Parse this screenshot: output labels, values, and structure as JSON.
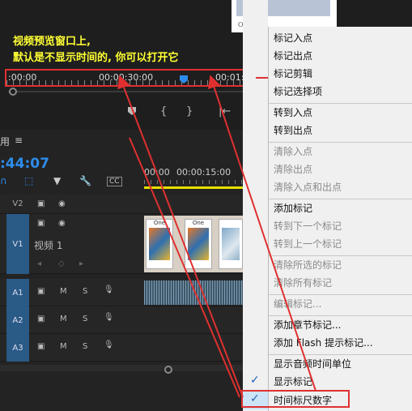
{
  "preview": {
    "thumb_caption": "One toy.",
    "annotation_line1": "视频预览窗口上,",
    "annotation_line2": "默认是不显示时间的, 你可以打开它",
    "time_labels": [
      ":00:00",
      "00:00:30:00",
      "00:01:"
    ]
  },
  "controls": {
    "in_icon": "{",
    "out_icon": "}",
    "goto_in_icon": "|←"
  },
  "timeline": {
    "tab_label": "用",
    "menu_icon": "≡",
    "timecode": ":44:07",
    "ruler_labels": [
      "00:00",
      "00:00:15:00"
    ],
    "cc_label": "CC",
    "tracks": {
      "v2": "V2",
      "v1": "V1",
      "v1_name": "视频 1",
      "a1": "A1",
      "a2": "A2",
      "a3": "A3",
      "mute": "M",
      "solo": "S"
    },
    "clip_frame_label": "One"
  },
  "menu": {
    "items": [
      {
        "label": "标记入点",
        "enabled": true
      },
      {
        "label": "标记出点",
        "enabled": true
      },
      {
        "label": "标记剪辑",
        "enabled": true
      },
      {
        "label": "标记选择项",
        "enabled": true
      },
      {
        "label": "转到入点",
        "enabled": true
      },
      {
        "label": "转到出点",
        "enabled": true
      },
      {
        "label": "清除入点",
        "enabled": false
      },
      {
        "label": "清除出点",
        "enabled": false
      },
      {
        "label": "清除入点和出点",
        "enabled": false
      },
      {
        "label": "添加标记",
        "enabled": true
      },
      {
        "label": "转到下一个标记",
        "enabled": false
      },
      {
        "label": "转到上一个标记",
        "enabled": false
      },
      {
        "label": "清除所选的标记",
        "enabled": false
      },
      {
        "label": "清除所有标记",
        "enabled": false
      },
      {
        "label": "编辑标记...",
        "enabled": false
      },
      {
        "label": "添加章节标记...",
        "enabled": true
      },
      {
        "label": "添加 Flash 提示标记...",
        "enabled": true
      },
      {
        "label": "显示音频时间单位",
        "enabled": true
      },
      {
        "label": "显示标记",
        "enabled": true,
        "checked": true
      },
      {
        "label": "时间标尺数字",
        "enabled": true,
        "checked": true
      }
    ],
    "check_glyph": "✓"
  },
  "colors": {
    "accent": "#2d8ceb",
    "annotation": "#ffff33",
    "highlight_border": "#e03030",
    "menu_bg": "#f0f0f0",
    "menu_highlight": "#cde4f7"
  }
}
